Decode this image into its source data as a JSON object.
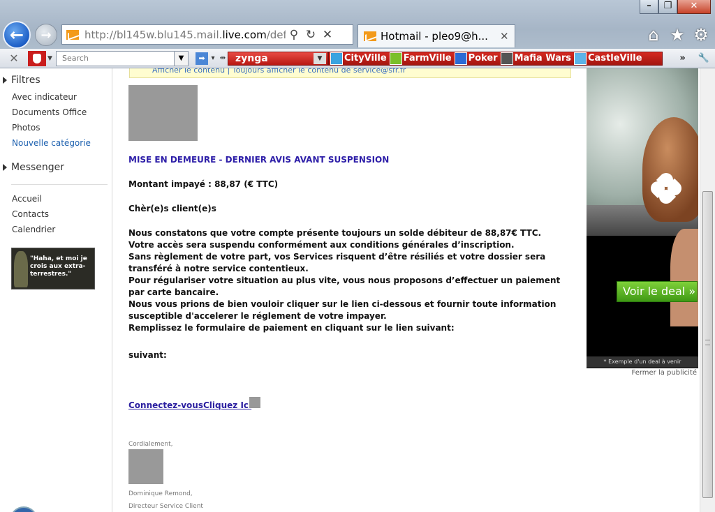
{
  "browser": {
    "address_url_prefix": "http://bl145w.blu145.mail.",
    "address_url_host": "live.com",
    "address_url_suffix": "/default",
    "tab_title": "Hotmail - pleo9@h...",
    "controls": {
      "minimize": "–",
      "maximize": "❐",
      "close": "✕"
    }
  },
  "toolbar": {
    "search_placeholder": "Search",
    "zynga_label": "zynga",
    "games": [
      {
        "label": "CityVille",
        "color": "#3aa3e0"
      },
      {
        "label": "FarmVille",
        "color": "#7bbf2a"
      },
      {
        "label": "Poker",
        "color": "#2b6bd6"
      },
      {
        "label": "Mafia Wars",
        "color": "#555555"
      },
      {
        "label": "CastleVille",
        "color": "#5bb3e8"
      }
    ],
    "more": "»"
  },
  "sidebar": {
    "filters_heading": "Filtres",
    "filters": [
      "Avec indicateur",
      "Documents Office",
      "Photos",
      "Nouvelle catégorie"
    ],
    "messenger_heading": "Messenger",
    "nav": [
      "Accueil",
      "Contacts",
      "Calendrier"
    ],
    "ad_text": "\"Haha, et moi je crois aux extra-terrestres.\""
  },
  "email": {
    "notice": "Afficher le contenu | Toujours afficher le contenu de service@sfr.fr",
    "title": "MISE EN DEMEURE - DERNIER AVIS AVANT SUSPENSION",
    "amount": "Montant impayé : 88,87 (€ TTC)",
    "greeting": "Chèr(e)s client(e)s",
    "body_lines": [
      "Nous constatons que votre compte présente toujours un solde débiteur de 88,87€ TTC.",
      "Votre accès sera suspendu conformément aux conditions générales d’inscription.",
      "Sans règlement de votre part, vos Services risquent d’être résiliés et votre dossier sera transféré à notre service contentieux.",
      "Pour régulariser votre situation au plus vite, vous nous proposons d’effectuer un paiement par carte bancaire.",
      "Nous vous prions de bien vouloir cliquer sur le lien ci-dessous et fournir toute information susceptible d'accelerer le réglement de votre impayer.",
      "Remplissez le formulaire de paiement en cliquant sur le lien suivant:"
    ],
    "suivant": "suivant:",
    "link": "Connectez-vousCliquez Ici ",
    "closing": "Cordialement,",
    "signature_name": "Dominique Remond,",
    "signature_title": "Directeur Service Client"
  },
  "ad": {
    "button": "Voir le deal »",
    "caption": "* Exemple d'un deal à venir",
    "close": "Fermer la publicité"
  }
}
